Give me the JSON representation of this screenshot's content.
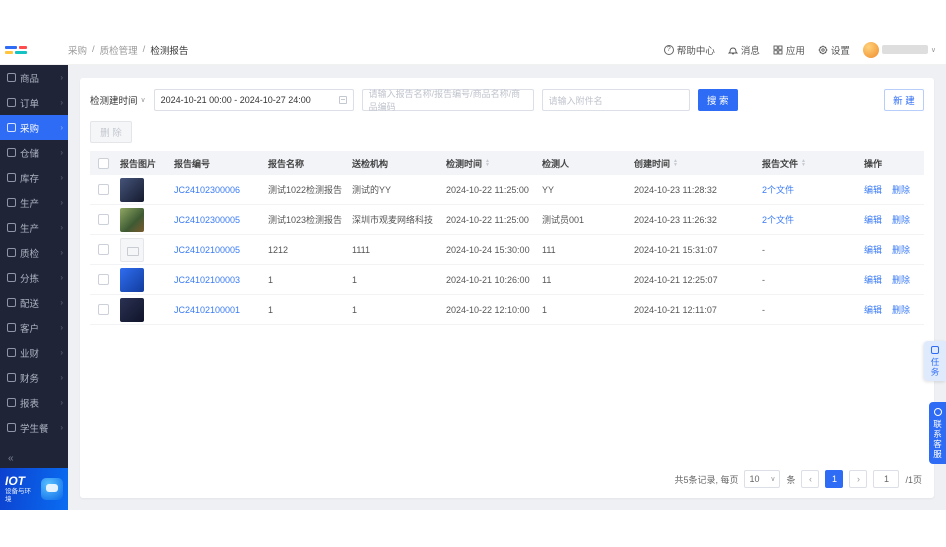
{
  "header": {
    "breadcrumb": {
      "sep": "/",
      "items": [
        "采购",
        "质检管理",
        "检测报告"
      ]
    },
    "help": "帮助中心",
    "messages": "消息",
    "apps": "应用",
    "settings": "设置"
  },
  "sidebar": {
    "items": [
      {
        "id": "goods",
        "icon": "goods-icon",
        "label": "商品",
        "active": false
      },
      {
        "id": "orders",
        "icon": "orders-icon",
        "label": "订单",
        "active": false
      },
      {
        "id": "purchase",
        "icon": "purchase-cart-icon",
        "label": "采购",
        "active": true
      },
      {
        "id": "warehouse",
        "icon": "warehouse-icon",
        "label": "仓储",
        "active": false
      },
      {
        "id": "inventory",
        "icon": "inventory-icon",
        "label": "库存",
        "active": false
      },
      {
        "id": "production",
        "icon": "production-icon",
        "label": "生产",
        "active": false
      },
      {
        "id": "production-2",
        "icon": "production-2-icon",
        "label": "生产",
        "active": false
      },
      {
        "id": "quality",
        "icon": "quality-check-icon",
        "label": "质检",
        "active": false
      },
      {
        "id": "sorting",
        "icon": "sorting-icon",
        "label": "分拣",
        "active": false
      },
      {
        "id": "delivery",
        "icon": "delivery-icon",
        "label": "配送",
        "active": false
      },
      {
        "id": "customers",
        "icon": "customers-icon",
        "label": "客户",
        "active": false
      },
      {
        "id": "biz-finance",
        "icon": "business-finance-icon",
        "label": "业财",
        "active": false
      },
      {
        "id": "finance",
        "icon": "finance-icon",
        "label": "财务",
        "active": false
      },
      {
        "id": "reports",
        "icon": "reports-icon",
        "label": "报表",
        "active": false
      },
      {
        "id": "student-meals",
        "icon": "student-meal-icon",
        "label": "学生餐",
        "active": false
      }
    ],
    "collapse": "«",
    "chevron": "›",
    "iot": {
      "title": "IOT",
      "subtitle": "设备与环境"
    }
  },
  "filters": {
    "time_label": "检测建时间",
    "caret": "∨",
    "date_range": "2024-10-21 00:00 - 2024-10-27 24:00",
    "keyword_placeholder": "请输入报告名称/报告编号/商品名称/商品编码",
    "attachment_placeholder": "请输入附件名",
    "search_label": "搜 索",
    "new_label": "新 建",
    "delete_label": "删 除"
  },
  "table": {
    "columns": [
      {
        "label": "报告图片",
        "sortable": false
      },
      {
        "label": "报告编号",
        "sortable": false
      },
      {
        "label": "报告名称",
        "sortable": false
      },
      {
        "label": "送检机构",
        "sortable": false
      },
      {
        "label": "检测时间",
        "sortable": true
      },
      {
        "label": "检测人",
        "sortable": false
      },
      {
        "label": "创建时间",
        "sortable": true
      },
      {
        "label": "报告文件",
        "sortable": true
      },
      {
        "label": "操作",
        "sortable": false
      }
    ],
    "actions": {
      "edit": "编辑",
      "delete": "删除"
    },
    "rows": [
      {
        "thumb": "photo-dark",
        "no": "JC24102300006",
        "name": "测试1022检测报告",
        "agency": "测试的YY",
        "test_time": "2024-10-22 11:25:00",
        "tester": "YY",
        "created": "2024-10-23 11:28:32",
        "files": "2个文件"
      },
      {
        "thumb": "photo-group",
        "no": "JC24102300005",
        "name": "测试1023检测报告",
        "agency": "深圳市观麦网络科技",
        "test_time": "2024-10-22 11:25:00",
        "tester": "测试员001",
        "created": "2024-10-23 11:26:32",
        "files": "2个文件"
      },
      {
        "thumb": "placeholder",
        "no": "JC24102100005",
        "name": "1212",
        "agency": "1111",
        "test_time": "2024-10-24 15:30:00",
        "tester": "111",
        "created": "2024-10-21 15:31:07",
        "files": "-"
      },
      {
        "thumb": "photo-blue",
        "no": "JC24102100003",
        "name": "1",
        "agency": "1",
        "test_time": "2024-10-21 10:26:00",
        "tester": "11",
        "created": "2024-10-21 12:25:07",
        "files": "-"
      },
      {
        "thumb": "photo-navy",
        "no": "JC24102100001",
        "name": "1",
        "agency": "1",
        "test_time": "2024-10-22 12:10:00",
        "tester": "1",
        "created": "2024-10-21 12:11:07",
        "files": "-"
      }
    ]
  },
  "pagination": {
    "total_prefix": "共5条记录, 每页",
    "per_page": "10",
    "unit": "条",
    "prev": "‹",
    "page": "1",
    "next": "›",
    "jump_value": "1",
    "jump_suffix": "/1页",
    "caret": "∨"
  },
  "floating": {
    "task": "任务",
    "service": "联系客服"
  }
}
